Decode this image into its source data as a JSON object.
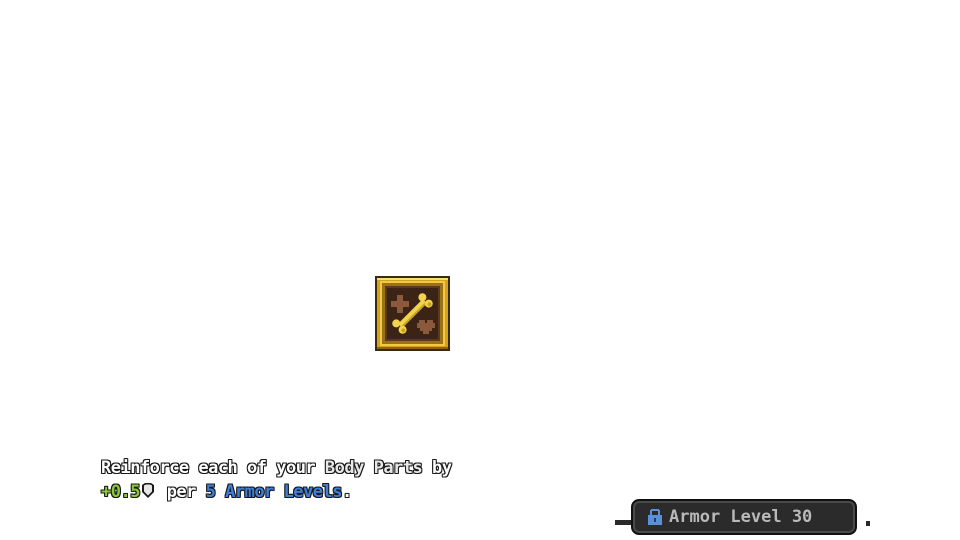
{
  "skill": {
    "icon": "bone-icon"
  },
  "description": {
    "line1": {
      "part1": "Reinforce each of your ",
      "part2": "Body Parts",
      "part3": " by"
    },
    "line2": {
      "bonus": "+0.5",
      "bonus_icon": "shield-icon",
      "per": " per ",
      "levels": "5 Armor Levels",
      "end": "."
    }
  },
  "requirement": {
    "icon": "lock-icon",
    "label": "Armor Level 30"
  },
  "colors": {
    "bonus": "#8cc63f",
    "highlight": "#3f7fd8",
    "frame_gold": "#d4a21c",
    "bone": "#f2d34a"
  }
}
